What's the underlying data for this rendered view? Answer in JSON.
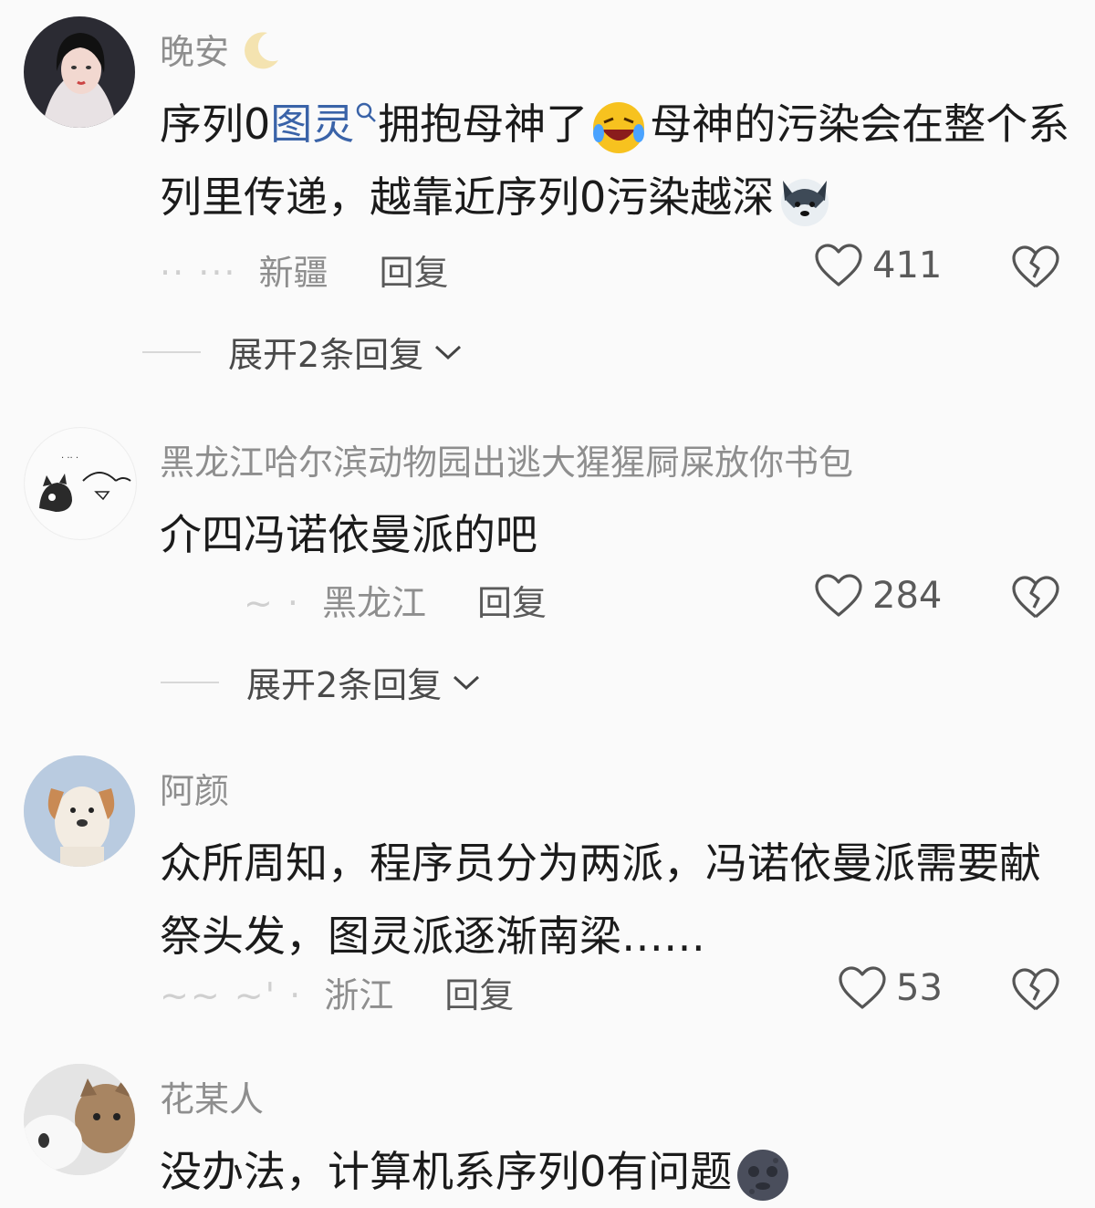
{
  "comments": [
    {
      "username": "晚安",
      "text_pre": "序列0",
      "link": "图灵",
      "text_mid": "拥抱母神了",
      "text_after_emoji": "母神的污染会在整个系列里传递，越靠近序列0污染越深",
      "date_blur": "·· ···",
      "location": "新疆",
      "reply_label": "回复",
      "likes": "411",
      "expand_label": "展开2条回复"
    },
    {
      "username": "黑龙江哈尔滨动物园出逃大猩猩屙屎放你书包",
      "text": "介四冯诺依曼派的吧",
      "date_blur": "~ ·",
      "location": "黑龙江",
      "reply_label": "回复",
      "likes": "284",
      "expand_label": "展开2条回复"
    },
    {
      "username": "阿颜",
      "text": "众所周知，程序员分为两派，冯诺依曼派需要献祭头发，图灵派逐渐南梁……",
      "date_blur": "~~ ~' ·",
      "location": "浙江",
      "reply_label": "回复",
      "likes": "53"
    },
    {
      "username": "花某人",
      "text": "没办法，计算机系序列0有问题"
    }
  ],
  "icons": {
    "like": "heart-outline-icon",
    "dislike": "broken-heart-icon",
    "expand": "chevron-down-icon"
  }
}
